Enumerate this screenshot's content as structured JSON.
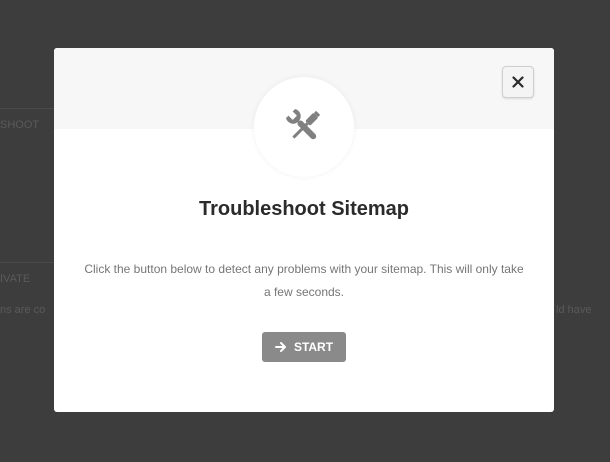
{
  "background": {
    "fragments": [
      "SHOOT",
      "IVATE",
      "ns are co",
      "ld have"
    ]
  },
  "modal": {
    "title": "Troubleshoot Sitemap",
    "description": "Click the button below to detect any problems with your sitemap. This will only take a few seconds.",
    "start_label": "START",
    "header_icon": "wrench-screwdriver-icon",
    "close_icon": "close-icon",
    "start_icon": "arrow-right-icon"
  },
  "colors": {
    "overlay": "#3d3d3d",
    "modal_bg": "#ffffff",
    "header_band": "#f7f7f7",
    "button_bg": "#8a8a8a",
    "title": "#2b2b2b",
    "text": "#767676"
  }
}
